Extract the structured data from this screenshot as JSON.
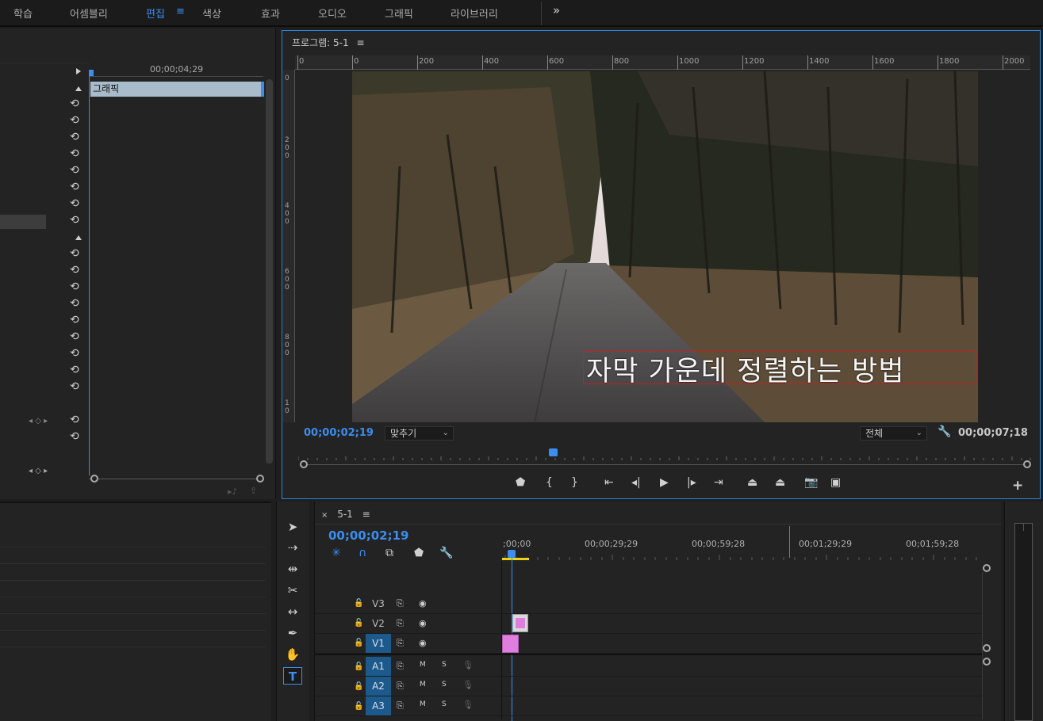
{
  "workspace_tabs": [
    "학습",
    "어셈블리",
    "편집",
    "색상",
    "효과",
    "오디오",
    "그래픽",
    "라이브러리"
  ],
  "workspace_active": "편집",
  "workspace_menu_icon": "≡",
  "workspace_more_icon": "»",
  "effect_controls": {
    "timecode": "00;00;04;29",
    "clip_label": "그래픽"
  },
  "program_monitor": {
    "title": "프로그램: 5-1",
    "menu_icon": "≡",
    "ruler_h": [
      "0",
      "0",
      "200",
      "400",
      "600",
      "800",
      "1000",
      "1200",
      "1400",
      "1600",
      "1800",
      "2000"
    ],
    "ruler_v": [
      "0",
      "200",
      "400",
      "600",
      "800",
      "10"
    ],
    "caption": "자막 가운데 정렬하는 방법",
    "timecode_current": "00;00;02;19",
    "fit_dropdown": "맞추기",
    "quality_dropdown": "전체",
    "timecode_duration": "00;00;07;18",
    "add_icon": "+"
  },
  "timeline": {
    "tab_title": "5-1",
    "close_icon": "×",
    "menu_icon": "≡",
    "timecode": "00;00;02;19",
    "ruler_times": [
      ";00;00",
      "00;00;29;29",
      "00;00;59;28",
      "00;01;29;29",
      "00;01;59;28"
    ],
    "video_tracks": [
      "V3",
      "V2",
      "V1"
    ],
    "audio_tracks": [
      "A1",
      "A2",
      "A3"
    ],
    "mute_label": "M",
    "solo_label": "S"
  },
  "colors": {
    "accent": "#3b8df0",
    "clip_pink": "#e07ee0",
    "caption_box": "#c42020",
    "inout_bar": "#e8d21c",
    "track_target": "#1d5a8c"
  },
  "icons": [
    "reset-icon",
    "play-icon",
    "step-back-icon",
    "step-forward-icon",
    "go-to-in-icon",
    "go-to-out-icon",
    "marker-icon",
    "mark-in-icon",
    "mark-out-icon",
    "lift-icon",
    "extract-icon",
    "camera-icon",
    "compare-icon",
    "wrench-icon",
    "selection-tool-icon",
    "track-select-icon",
    "ripple-edit-icon",
    "razor-icon",
    "slip-icon",
    "pen-icon",
    "hand-icon",
    "type-icon",
    "lock-icon",
    "eye-icon",
    "mic-icon"
  ]
}
